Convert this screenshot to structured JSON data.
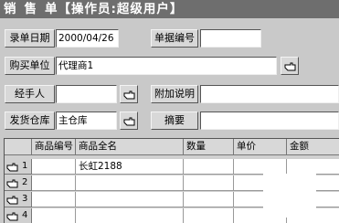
{
  "window": {
    "title_parts": [
      "销",
      "售",
      "单【操作员:超级用户】"
    ]
  },
  "form": {
    "entry_date": {
      "label": "录单日期",
      "value": "2000/04/26"
    },
    "doc_no": {
      "label": "单据编号",
      "value": ""
    },
    "buyer": {
      "label": "购买单位",
      "value": "代理商1"
    },
    "handler": {
      "label": "经手人",
      "value": ""
    },
    "note": {
      "label": "附加说明",
      "value": ""
    },
    "warehouse": {
      "label": "发货仓库",
      "value": "主仓库"
    },
    "summary": {
      "label": "摘要",
      "value": ""
    }
  },
  "grid": {
    "columns": [
      "商品编号",
      "商品全名",
      "数量",
      "单价",
      "金额"
    ],
    "rows": [
      {
        "no": "1",
        "code": "",
        "name": "长虹2188",
        "qty": "",
        "price": "",
        "amount": ""
      },
      {
        "no": "2",
        "code": "",
        "name": "",
        "qty": "",
        "price": "",
        "amount": ""
      },
      {
        "no": "3",
        "code": "",
        "name": "",
        "qty": "",
        "price": "",
        "amount": ""
      },
      {
        "no": "4",
        "code": "",
        "name": "",
        "qty": "",
        "price": "",
        "amount": ""
      }
    ]
  },
  "icons": {
    "picker": "hand-pointer-icon",
    "row_pointer": "hand-pointer-icon"
  }
}
